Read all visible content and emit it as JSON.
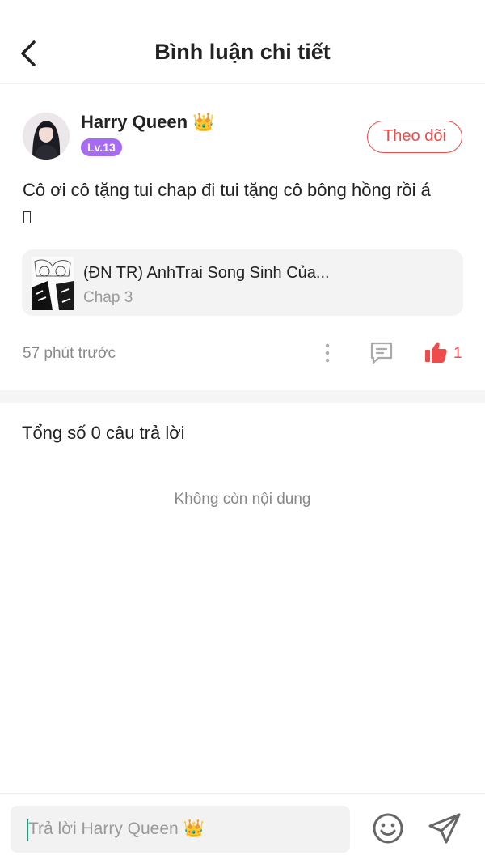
{
  "header": {
    "title": "Bình luận chi tiết",
    "back_icon": "chevron-left-icon"
  },
  "comment": {
    "author": {
      "name": "Harry Queen",
      "name_emoji": "👑",
      "level": "Lv.13",
      "follow_label": "Theo dõi"
    },
    "text": "Cô ơi cô tặng tui chap đi tui tặng cô bông hồng rồi á",
    "manga": {
      "title": "(ĐN TR) AnhTrai Song Sinh Của...",
      "chapter": "Chap 3"
    },
    "time": "57 phút trước",
    "like_count": "1"
  },
  "replies": {
    "count_text": "Tổng số 0 câu trả lời",
    "empty_text": "Không còn nội dung"
  },
  "reply_bar": {
    "placeholder": "Trả lời Harry Queen 👑"
  },
  "colors": {
    "accent": "#ef4b4b",
    "level_badge": "#a76af3",
    "caret": "#16a085"
  }
}
